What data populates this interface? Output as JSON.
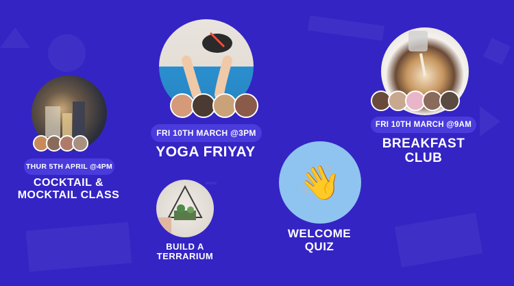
{
  "colors": {
    "background": "#3424c4",
    "pill": "#4a3bdc",
    "quiz_circle": "#8fc4f0",
    "text": "#ffffff"
  },
  "events": {
    "cocktail": {
      "date": "THUR 5TH APRIL @4PM",
      "title_line1": "COCKTAIL &",
      "title_line2": "MOCKTAIL CLASS",
      "image_icon": "cocktail-photo"
    },
    "yoga": {
      "date": "FRI 10TH MARCH @3PM",
      "title": "YOGA FRIYAY",
      "image_icon": "yoga-mat-photo"
    },
    "breakfast": {
      "date": "FRI 10TH MARCH @9AM",
      "title_line1": "BREAKFAST",
      "title_line2": "CLUB",
      "image_icon": "latte-art-photo"
    },
    "terrarium": {
      "title_line1": "BUILD A",
      "title_line2": "TERRARIUM",
      "image_icon": "terrarium-photo"
    },
    "quiz": {
      "title_line1": "WELCOME",
      "title_line2": "QUIZ",
      "emoji": "👋"
    }
  }
}
